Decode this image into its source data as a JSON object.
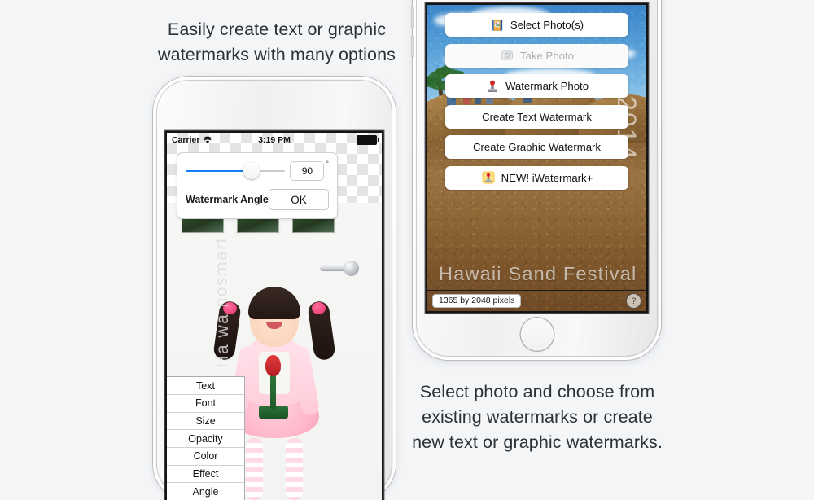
{
  "background_color": "#f3f5f7",
  "captions": {
    "left": {
      "lines": [
        "Easily create text or graphic",
        "watermarks with many options"
      ]
    },
    "right": {
      "lines": [
        "Select photo and choose from",
        "existing watermarks or create",
        "new text or graphic watermarks."
      ]
    }
  },
  "left_phone": {
    "status_bar": {
      "carrier": "Carrier",
      "wifi_icon": "wifi-icon",
      "time": "3:19 PM",
      "battery_icon": "battery-full-icon"
    },
    "angle_dialog": {
      "slider_value": 90,
      "slider_percent": 66,
      "value_text": "90",
      "degree_symbol": "°",
      "label": "Watermark Angle",
      "ok_label": "OK",
      "accent_color": "#147efb"
    },
    "photo": {
      "watermark_text": "Ha wa nosmart",
      "alt": "young girl in pink holding a red tulip in front of a white door"
    },
    "option_list": [
      "Text",
      "Font",
      "Size",
      "Opacity",
      "Color",
      "Effect",
      "Angle"
    ]
  },
  "right_phone": {
    "menu_buttons": [
      {
        "label": "Select Photo(s)",
        "icon": "photo-album-icon",
        "disabled": false
      },
      {
        "label": "Take Photo",
        "icon": "camera-icon",
        "disabled": true
      },
      {
        "label": "Watermark Photo",
        "icon": "stamp-icon",
        "disabled": false
      },
      {
        "label": "Create Text Watermark",
        "icon": "",
        "disabled": false
      },
      {
        "label": "Create Graphic Watermark",
        "icon": "",
        "disabled": false
      },
      {
        "label": "NEW! iWatermark+",
        "icon": "iwatermark-plus-app-icon",
        "disabled": false
      }
    ],
    "photo": {
      "watermark_text": "Hawaii Sand Festival",
      "watermark_year": "2014",
      "alt": "sand sculpture festival on a beach under blue sky"
    },
    "bottom_bar": {
      "dimensions_label": "1365 by 2048 pixels",
      "help_label": "?"
    }
  }
}
